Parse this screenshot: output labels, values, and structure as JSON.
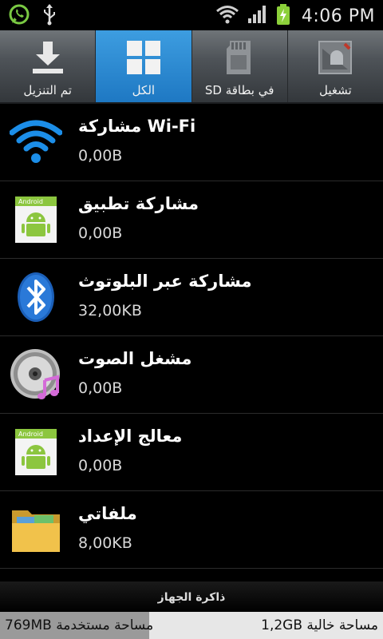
{
  "status_bar": {
    "time": "4:06 PM",
    "icons": [
      "whatsapp-icon",
      "usb-icon",
      "wifi-icon",
      "signal-icon",
      "battery-charging-icon"
    ]
  },
  "tabs": [
    {
      "label": "تم التنزيل",
      "icon": "download-icon",
      "active": false
    },
    {
      "label": "الكل",
      "icon": "grid-icon",
      "active": true
    },
    {
      "label": "في بطاقة SD",
      "icon": "sd-card-icon",
      "active": false
    },
    {
      "label": "تشغيل",
      "icon": "running-icon",
      "active": false
    }
  ],
  "apps": [
    {
      "name": "مشاركة Wi-Fi",
      "size": "0,00B",
      "icon": "wifi-share-icon"
    },
    {
      "name": "مشاركة تطبيق",
      "size": "0,00B",
      "icon": "android-app-icon"
    },
    {
      "name": "مشاركة عبر البلوتوث",
      "size": "32,00KB",
      "icon": "bluetooth-icon"
    },
    {
      "name": "مشغل الصوت",
      "size": "0,00B",
      "icon": "music-player-icon"
    },
    {
      "name": "معالج الإعداد",
      "size": "0,00B",
      "icon": "android-app-icon"
    },
    {
      "name": "ملفاتي",
      "size": "8,00KB",
      "icon": "folder-icon"
    }
  ],
  "storage": {
    "title": "ذاكرة الجهاز",
    "used_label": "مساحة مستخدمة",
    "used_value": "769MB",
    "free_label": "مساحة خالية",
    "free_value": "1,2GB",
    "used_fraction": 0.39,
    "colors": {
      "used": "#9a9a9a",
      "free": "#e7e7e7"
    }
  },
  "colors": {
    "active_tab": "#2a8ad6",
    "background": "#000000"
  }
}
